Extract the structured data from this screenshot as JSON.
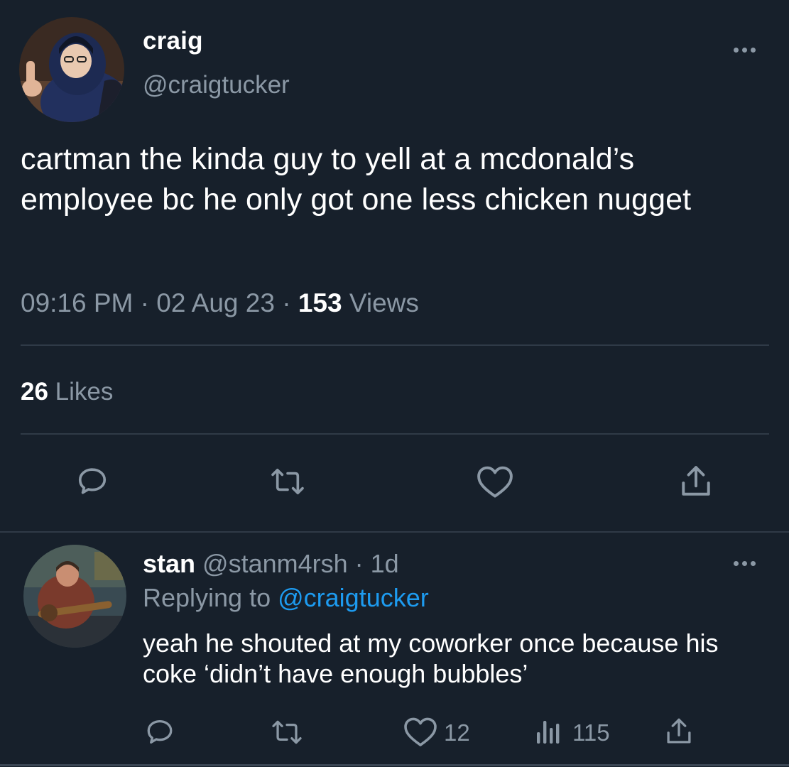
{
  "colors": {
    "background": "#17202b",
    "primary_text": "#ffffff",
    "secondary_text": "#8b98a5",
    "divider": "#2f3a47",
    "link": "#1d9bf0"
  },
  "main_tweet": {
    "display_name": "craig",
    "handle": "@craigtucker",
    "avatar_icon": "user-avatar",
    "more_icon": "more-dots-icon",
    "text": "cartman the kinda guy to yell at a mcdonald’s employee bc he only got one less chicken nugget",
    "time": "09:16 PM",
    "separator": " · ",
    "date": "02 Aug 23",
    "views_count": "153",
    "views_label": "Views",
    "likes_count": "26",
    "likes_label": "Likes",
    "actions": {
      "reply_icon": "reply-icon",
      "retweet_icon": "retweet-icon",
      "like_icon": "heart-icon",
      "share_icon": "share-icon"
    }
  },
  "reply_tweet": {
    "display_name": "stan",
    "handle": "@stanm4rsh",
    "age": "1d",
    "replying_prefix": "Replying to",
    "replying_to": "@craigtucker",
    "text": "yeah he shouted at my coworker once because his coke ‘didn’t have enough bubbles’",
    "like_count": "12",
    "views_count": "115",
    "actions": {
      "reply_icon": "reply-icon",
      "retweet_icon": "retweet-icon",
      "like_icon": "heart-icon",
      "views_icon": "bar-chart-icon",
      "share_icon": "share-icon"
    }
  }
}
